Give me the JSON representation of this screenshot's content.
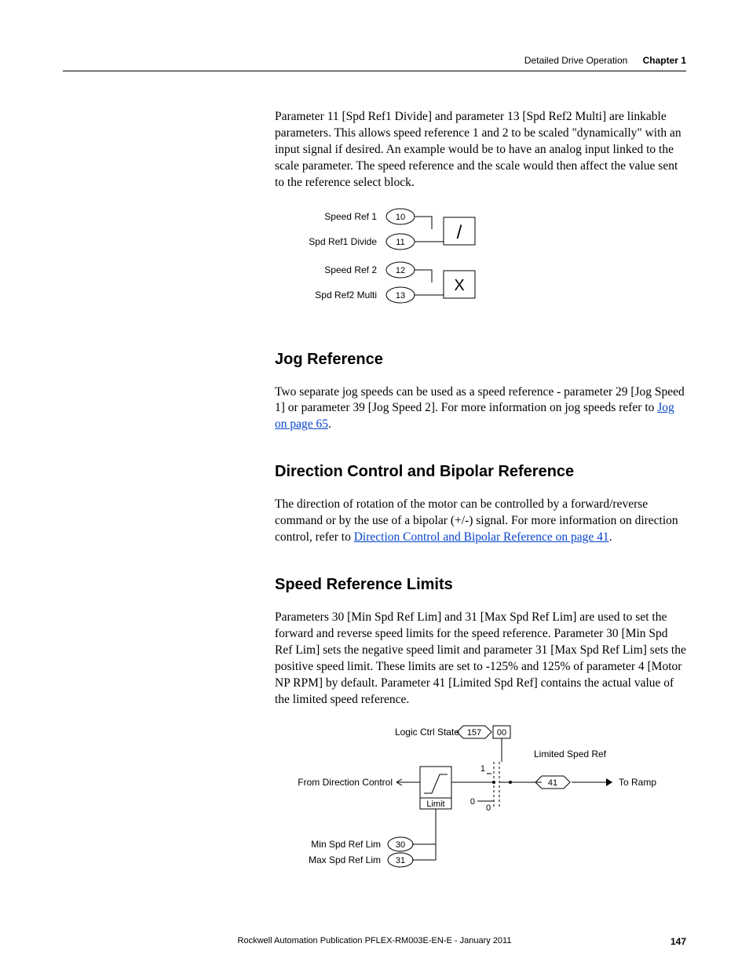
{
  "header": {
    "section": "Detailed Drive Operation",
    "chapter": "Chapter 1"
  },
  "para1": "Parameter 11 [Spd Ref1 Divide] and parameter 13 [Spd Ref2 Multi] are linkable parameters. This allows speed reference 1 and 2 to be scaled \"dynamically\" with an input signal if desired. An example would be to have an analog input linked to the scale parameter. The speed reference and the scale would then affect the value sent to the reference select block.",
  "diagram1": {
    "r1_label": "Speed Ref 1",
    "r1_num": "10",
    "r2_label": "Spd Ref1 Divide",
    "r2_num": "11",
    "r3_label": "Speed Ref 2",
    "r3_num": "12",
    "r4_label": "Spd Ref2 Multi",
    "r4_num": "13",
    "op1": "/",
    "op2": "X"
  },
  "h_jog": "Jog Reference",
  "jog_text_a": "Two separate jog speeds can be used as a speed reference - parameter 29 [Jog Speed 1] or parameter 39 [Jog Speed 2]. For more information on jog speeds refer to ",
  "jog_link": "Jog on page 65",
  "h_dir": "Direction Control and Bipolar Reference",
  "dir_text_a": "The direction of rotation of the motor can be controlled by a forward/reverse command or by the use of a bipolar (+/-) signal. For more information on direction control, refer to ",
  "dir_link": "Direction Control and Bipolar Reference on page 41",
  "h_spd": "Speed Reference Limits",
  "spd_text": "Parameters 30 [Min Spd Ref Lim] and 31 [Max Spd Ref Lim] are used to set the forward and reverse speed limits for the speed reference. Parameter 30 [Min Spd Ref Lim] sets the negative speed limit and parameter 31 [Max Spd Ref Lim] sets the positive speed limit. These limits are set to -125% and 125% of parameter 4 [Motor NP RPM] by default. Parameter 41 [Limited Spd Ref] contains the actual value of the limited speed reference.",
  "diagram2": {
    "logic_label": "Logic Ctrl State",
    "logic_num": "157",
    "logic_bit": "00",
    "limited_label": "Limited Sped Ref",
    "from_label": "From Direction Control",
    "limit_label": "Limit",
    "sw_1": "1",
    "sw_0a": "0",
    "sw_0b": "0",
    "out_num": "41",
    "to_ramp": "To Ramp",
    "min_label": "Min Spd Ref Lim",
    "min_num": "30",
    "max_label": "Max Spd Ref Lim",
    "max_num": "31"
  },
  "footer": {
    "pub": "Rockwell Automation Publication PFLEX-RM003E-EN-E - January 2011",
    "page": "147"
  }
}
